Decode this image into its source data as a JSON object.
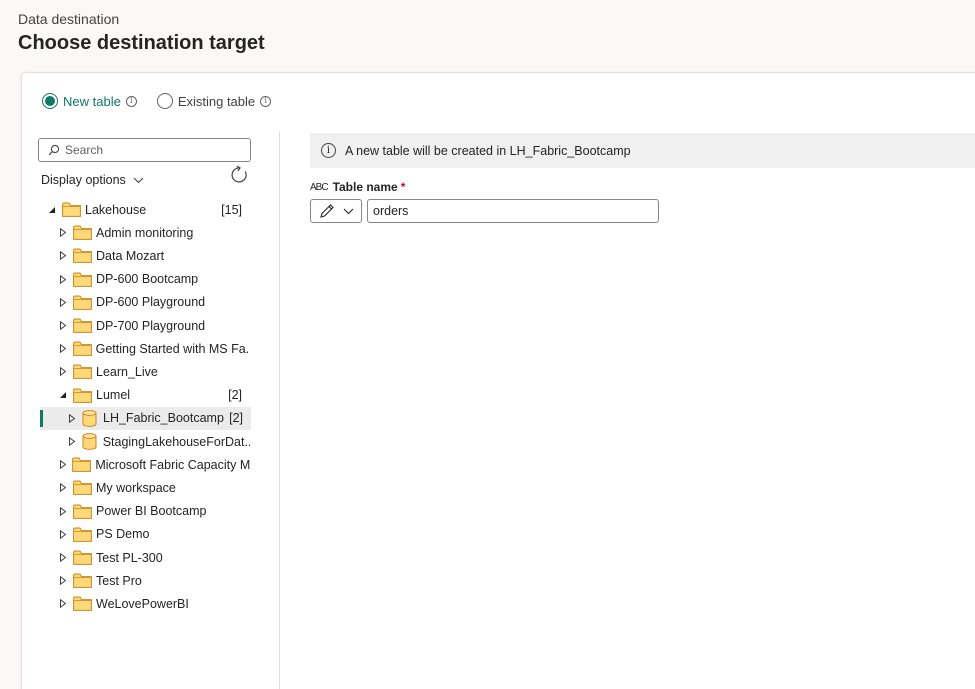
{
  "header": {
    "subtitle": "Data destination",
    "title": "Choose destination target"
  },
  "radios": [
    {
      "label": "New table",
      "selected": true
    },
    {
      "label": "Existing table",
      "selected": false
    }
  ],
  "search": {
    "placeholder": "Search"
  },
  "display_options": {
    "label": "Display options"
  },
  "tree": [
    {
      "label": "Lakehouse",
      "count": "[15]",
      "level": 0,
      "expanded": true,
      "kind": "folder"
    },
    {
      "label": "Admin monitoring",
      "count": "",
      "level": 1,
      "expanded": false,
      "kind": "folder"
    },
    {
      "label": "Data Mozart",
      "count": "",
      "level": 1,
      "expanded": false,
      "kind": "folder"
    },
    {
      "label": "DP-600 Bootcamp",
      "count": "",
      "level": 1,
      "expanded": false,
      "kind": "folder"
    },
    {
      "label": "DP-600 Playground",
      "count": "",
      "level": 1,
      "expanded": false,
      "kind": "folder"
    },
    {
      "label": "DP-700 Playground",
      "count": "",
      "level": 1,
      "expanded": false,
      "kind": "folder"
    },
    {
      "label": "Getting Started with MS Fa...",
      "count": "",
      "level": 1,
      "expanded": false,
      "kind": "folder"
    },
    {
      "label": "Learn_Live",
      "count": "",
      "level": 1,
      "expanded": false,
      "kind": "folder"
    },
    {
      "label": "Lumel",
      "count": "[2]",
      "level": 1,
      "expanded": true,
      "kind": "folder"
    },
    {
      "label": "LH_Fabric_Bootcamp",
      "count": "[2]",
      "level": 2,
      "expanded": false,
      "kind": "lakehouse",
      "selected": true
    },
    {
      "label": "StagingLakehouseForDat...",
      "count": "",
      "level": 2,
      "expanded": false,
      "kind": "lakehouse"
    },
    {
      "label": "Microsoft Fabric Capacity M...",
      "count": "",
      "level": 1,
      "expanded": false,
      "kind": "folder"
    },
    {
      "label": "My workspace",
      "count": "",
      "level": 1,
      "expanded": false,
      "kind": "folder"
    },
    {
      "label": "Power BI Bootcamp",
      "count": "",
      "level": 1,
      "expanded": false,
      "kind": "folder"
    },
    {
      "label": "PS Demo",
      "count": "",
      "level": 1,
      "expanded": false,
      "kind": "folder"
    },
    {
      "label": "Test PL-300",
      "count": "",
      "level": 1,
      "expanded": false,
      "kind": "folder"
    },
    {
      "label": "Test Pro",
      "count": "",
      "level": 1,
      "expanded": false,
      "kind": "folder"
    },
    {
      "label": "WeLovePowerBI",
      "count": "",
      "level": 1,
      "expanded": false,
      "kind": "folder"
    }
  ],
  "info_message": "A new table will be created in LH_Fabric_Bootcamp",
  "table_name": {
    "abc_glyph": "ABC",
    "label": "Table name",
    "required_mark": "*",
    "value": "orders"
  },
  "colors": {
    "accent": "#117865",
    "folder_fill": "#ffd87a",
    "folder_stroke": "#c8871e"
  }
}
